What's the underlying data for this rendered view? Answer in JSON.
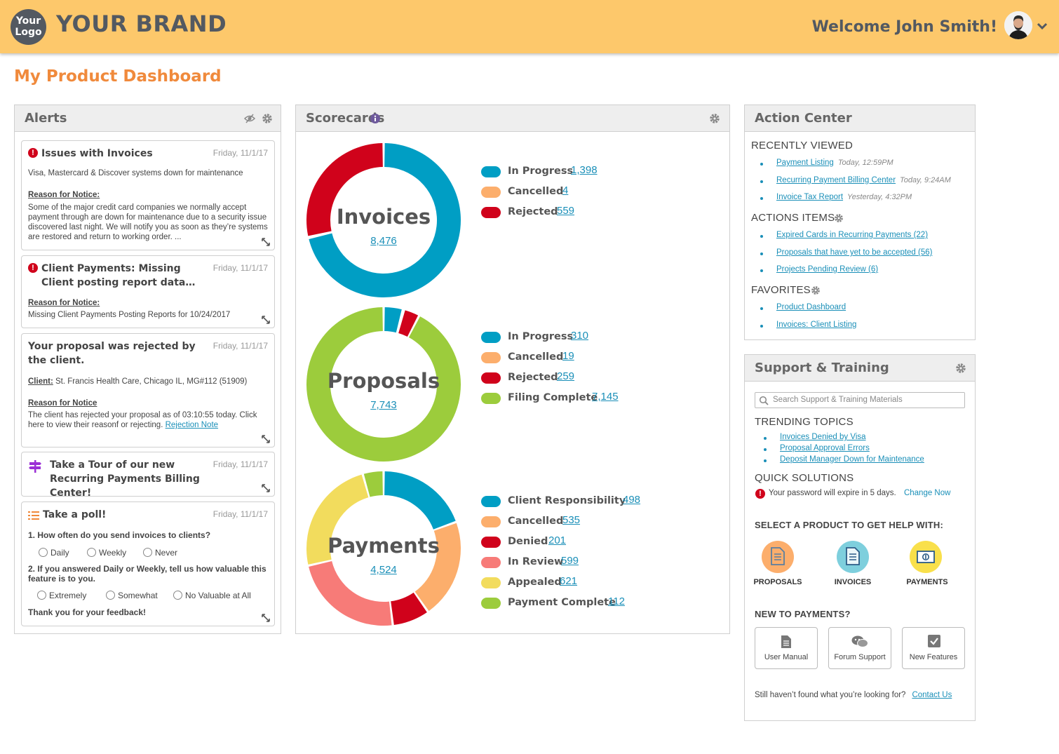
{
  "header": {
    "logo_line1": "Your",
    "logo_line2": "Logo",
    "brand": "YOUR BRAND",
    "welcome": "Welcome John Smith!"
  },
  "page_title": "My Product Dashboard",
  "alerts": {
    "title": "Alerts",
    "cards": [
      {
        "title": "Issues with Invoices",
        "date": "Friday, 11/1/17",
        "summary": "Visa, Mastercard & Discover systems down for maintenance",
        "reason_label": "Reason for Notice:",
        "reason_text": "Some of the major credit card companies we normally accept payment through are down for maintenance due to a security issue discovered last night. We will notify you as soon as they’re systems are restored and return to working order. ..."
      },
      {
        "title": "Client Payments: Missing Client posting report data…",
        "date": "Friday, 11/1/17",
        "reason_label": "Reason for Notice:",
        "reason_text": "Missing Client Payments Posting Reports for 10/24/2017"
      },
      {
        "title": "Your proposal was rejected by the client.",
        "date": "Friday, 11/1/17",
        "client_label": "Client:",
        "client_text": "St. Francis Health Care, Chicago IL, MG#112 (51909)",
        "reason_label": "Reason for Notice",
        "reason_text": "The client has rejected your proposal as of 03:10:55 today. Click here to view their reasonf or rejecting.",
        "reason_link": "Rejection Note"
      },
      {
        "title": "Take a Tour of our new Recurring Payments Billing Center!",
        "date": "Friday, 11/1/17"
      },
      {
        "title": "Take a poll!",
        "date": "Friday, 11/1/17",
        "q1": "1. How often do you send invoices to clients?",
        "q1_options": [
          "Daily",
          "Weekly",
          "Never"
        ],
        "q2": "2. If you answered Daily or Weekly, tell us how valuable this feature is to you.",
        "q2_options": [
          "Extremely",
          "Somewhat",
          "No Valuable at All"
        ],
        "thanks": "Thank you for your feedback!"
      }
    ]
  },
  "scorecards": {
    "title": "Scorecards",
    "charts": [
      {
        "name": "Invoices",
        "total": "8,476",
        "items": [
          {
            "label": "In Progress",
            "value": "1,398",
            "color": "#009ec4"
          },
          {
            "label": "Cancelled",
            "value": "4",
            "color": "#fcae6c"
          },
          {
            "label": "Rejected",
            "value": "559",
            "color": "#d0021b"
          }
        ]
      },
      {
        "name": "Proposals",
        "total": "7,743",
        "items": [
          {
            "label": "In Progress",
            "value": "310",
            "color": "#009ec4"
          },
          {
            "label": "Cancelled",
            "value": "19",
            "color": "#fcae6c"
          },
          {
            "label": "Rejected",
            "value": "259",
            "color": "#d0021b"
          },
          {
            "label": "Filing Complete",
            "value": "7,145",
            "color": "#9ccc3c"
          }
        ]
      },
      {
        "name": "Payments",
        "total": "4,524",
        "items": [
          {
            "label": "Client Responsibility",
            "value": "498",
            "color": "#009ec4"
          },
          {
            "label": "Cancelled",
            "value": "535",
            "color": "#fcae6c"
          },
          {
            "label": "Denied",
            "value": "201",
            "color": "#d0021b"
          },
          {
            "label": "In Review",
            "value": "599",
            "color": "#f77b78"
          },
          {
            "label": "Appealed",
            "value": "621",
            "color": "#f2dc5d"
          },
          {
            "label": "Payment Complete",
            "value": "112",
            "color": "#9ccc3c"
          }
        ]
      }
    ]
  },
  "action_center": {
    "title": "Action Center",
    "recently_viewed_heading": "RECENTLY VIEWED",
    "recently_viewed": [
      {
        "label": "Payment Listing",
        "time": "Today, 12:59PM"
      },
      {
        "label": "Recurring Payment Billing Center",
        "time": "Today, 9:24AM"
      },
      {
        "label": "Invoice Tax Report",
        "time": "Yesterday, 4:32PM"
      }
    ],
    "action_items_heading": "ACTIONS ITEMS",
    "action_items": [
      "Expired Cards in Recurring Payments (22)",
      "Proposals that have yet to be accepted (56)",
      "Projects Pending Review (6)"
    ],
    "favorites_heading": "FAVORITES",
    "favorites": [
      "Product Dashboard",
      "Invoices: Client Listing"
    ]
  },
  "support": {
    "title": "Support & Training",
    "search_placeholder": "Search Support & Training Materials",
    "trending_heading": "TRENDING TOPICS",
    "trending": [
      "Invoices Denied by Visa",
      "Proposal Approval Errors",
      "Deposit Manager Down for Maintenance"
    ],
    "quick_heading": "QUICK SOLUTIONS",
    "quick_text": "Your password will expire in 5 days.",
    "quick_link": "Change Now",
    "select_heading": "SELECT A PRODUCT TO GET HELP WITH:",
    "products": [
      {
        "label": "PROPOSALS",
        "color": "#fcae6c",
        "icon": "document-icon"
      },
      {
        "label": "INVOICES",
        "color": "#7ecfdd",
        "icon": "document-icon"
      },
      {
        "label": "PAYMENTS",
        "color": "#f9e04b",
        "icon": "cash-icon"
      }
    ],
    "new_heading": "NEW TO PAYMENTS?",
    "buttons": [
      "User Manual",
      "Forum Support",
      "New Features"
    ],
    "footer_text": "Still haven’t found what you’re looking for?",
    "footer_link": "Contact Us"
  }
}
